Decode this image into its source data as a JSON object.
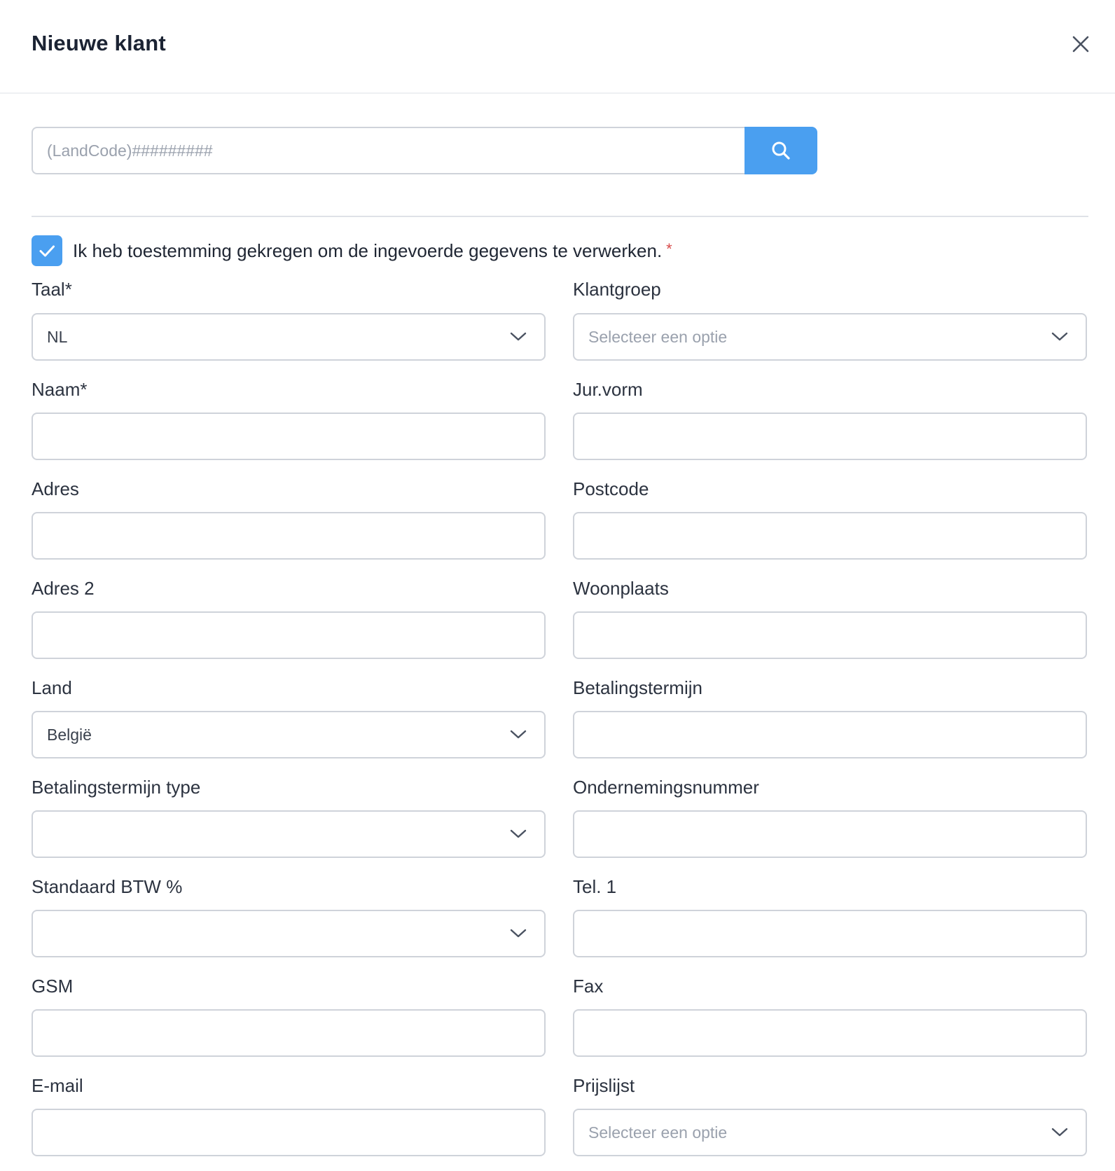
{
  "dialog": {
    "title": "Nieuwe klant"
  },
  "search": {
    "placeholder": "(LandCode)#########"
  },
  "consent": {
    "text": "Ik heb toestemming gekregen om de ingevoerde gegevens te verwerken.",
    "required_mark": "*",
    "checked": true
  },
  "fields": {
    "taal": {
      "label": "Taal*",
      "value": "NL"
    },
    "klantgroep": {
      "label": "Klantgroep",
      "placeholder": "Selecteer een optie"
    },
    "naam": {
      "label": "Naam*",
      "value": ""
    },
    "jurvorm": {
      "label": "Jur.vorm",
      "value": ""
    },
    "adres": {
      "label": "Adres",
      "value": ""
    },
    "postcode": {
      "label": "Postcode",
      "value": ""
    },
    "adres2": {
      "label": "Adres 2",
      "value": ""
    },
    "woonplaats": {
      "label": "Woonplaats",
      "value": ""
    },
    "land": {
      "label": "Land",
      "value": "België"
    },
    "betalingstermijn": {
      "label": "Betalingstermijn",
      "value": ""
    },
    "betalingstermijn_type": {
      "label": "Betalingstermijn type",
      "value": ""
    },
    "ondernemingsnummer": {
      "label": "Ondernemingsnummer",
      "value": ""
    },
    "standaard_btw": {
      "label": "Standaard BTW %",
      "value": ""
    },
    "tel1": {
      "label": "Tel. 1",
      "value": ""
    },
    "gsm": {
      "label": "GSM",
      "value": ""
    },
    "fax": {
      "label": "Fax",
      "value": ""
    },
    "email": {
      "label": "E-mail",
      "value": ""
    },
    "prijslijst": {
      "label": "Prijslijst",
      "placeholder": "Selecteer een optie"
    }
  },
  "icons": {
    "close": "close-icon",
    "search": "search-icon",
    "check": "check-icon",
    "chevron": "chevron-down-icon"
  },
  "colors": {
    "accent": "#4a9ff0",
    "border": "#cfd3da",
    "required": "#d84a4a"
  }
}
